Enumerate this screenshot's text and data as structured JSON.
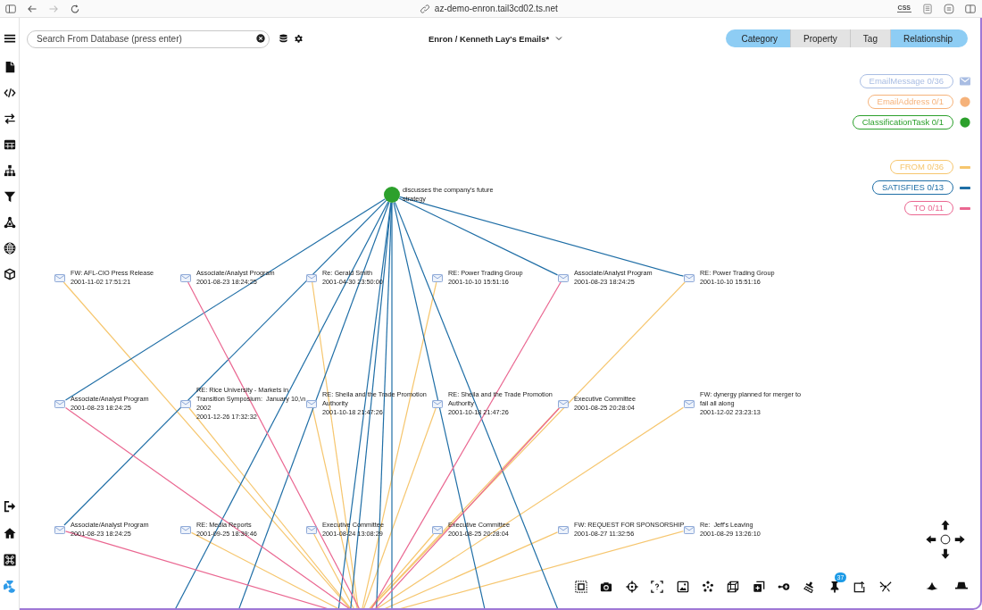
{
  "browser": {
    "url": "az-demo-enron.tail3cd02.ts.net",
    "extension_label": "CSS"
  },
  "header": {
    "search": {
      "placeholder": "Search From Database (press enter)"
    },
    "title": "Enron / Kenneth Lay's Emails*",
    "view_modes": [
      {
        "label": "Category",
        "selected": true
      },
      {
        "label": "Property",
        "selected": false
      },
      {
        "label": "Tag",
        "selected": false
      },
      {
        "label": "Relationship",
        "selected": true
      }
    ]
  },
  "legend": {
    "categories": [
      {
        "label": "EmailMessage 0/36",
        "kind": "message",
        "color": "#a9bde3"
      },
      {
        "label": "EmailAddress 0/1",
        "kind": "address",
        "color": "#f5b27a"
      },
      {
        "label": "ClassificationTask 0/1",
        "kind": "task",
        "color": "#2ca02c"
      }
    ],
    "relationships": [
      {
        "label": "FROM 0/36",
        "kind": "from",
        "color": "#f6c66e"
      },
      {
        "label": "SATISFIES 0/13",
        "kind": "satisfies",
        "color": "#1f6ea6"
      },
      {
        "label": "TO 0/11",
        "kind": "to",
        "color": "#ea6791"
      }
    ]
  },
  "graph": {
    "task_node": {
      "label": "discusses the company's future strategy"
    },
    "email_nodes": [
      {
        "title": "FW: AFL-CIO Press Release",
        "date": "2001-11-02 17:51:21",
        "links": [
          {
            "kind": "from"
          }
        ]
      },
      {
        "title": "Associate/Analyst Program",
        "date": "2001-08-23 18:24:25",
        "links": [
          {
            "kind": "to"
          }
        ]
      },
      {
        "title": "Re: Gerald Smith",
        "date": "2001-04-30 23:50:00",
        "links": [
          {
            "kind": "from"
          }
        ]
      },
      {
        "title": "RE: Power Trading Group",
        "date": "2001-10-10 15:51:16",
        "links": [
          {
            "kind": "from"
          }
        ]
      },
      {
        "title": "Associate/Analyst Program",
        "date": "2001-08-23 18:24:25",
        "links": [
          {
            "kind": "satisfies"
          },
          {
            "kind": "to"
          }
        ]
      },
      {
        "title": "RE: Power Trading Group",
        "date": "2001-10-10 15:51:16",
        "links": [
          {
            "kind": "satisfies"
          },
          {
            "kind": "from"
          }
        ]
      },
      {
        "title": "Associate/Analyst Program",
        "date": "2001-08-23 18:24:25",
        "links": [
          {
            "kind": "satisfies"
          },
          {
            "kind": "to"
          }
        ]
      },
      {
        "title": "RE: Rice University - Markets in Transition Symposium:  January 10,\\n 2002",
        "date": "2001-12-26 17:32:32",
        "links": [
          {
            "kind": "from"
          }
        ]
      },
      {
        "title": "RE: Sheila and the Trade Promotion Authority",
        "date": "2001-10-18 21:47:26",
        "links": [
          {
            "kind": "from"
          }
        ]
      },
      {
        "title": "RE: Sheila and the Trade Promotion Authority",
        "date": "2001-10-18 21:47:26",
        "links": [
          {
            "kind": "from"
          }
        ]
      },
      {
        "title": "Executive Committee",
        "date": "2001-08-25 20:28:04",
        "links": [
          {
            "kind": "from"
          },
          {
            "kind": "to"
          }
        ]
      },
      {
        "title": "FW: dynergy planned for merger to fail all along",
        "date": "2001-12-02 23:23:13",
        "links": [
          {
            "kind": "from"
          }
        ]
      },
      {
        "title": "Associate/Analyst Program",
        "date": "2001-08-23 18:24:25",
        "links": [
          {
            "kind": "satisfies"
          },
          {
            "kind": "to"
          }
        ]
      },
      {
        "title": "RE: Media Reports",
        "date": "2001-09-25 18:39:46",
        "links": [
          {
            "kind": "from"
          }
        ]
      },
      {
        "title": "Executive Committee",
        "date": "2001-08-24 13:08:29",
        "links": [
          {
            "kind": "from"
          }
        ]
      },
      {
        "title": "Executive Committee",
        "date": "2001-08-25 20:28:04",
        "links": [
          {
            "kind": "from"
          }
        ]
      },
      {
        "title": "FW: REQUEST FOR SPONSORSHIP",
        "date": "2001-08-27 11:32:56",
        "links": [
          {
            "kind": "from"
          }
        ]
      },
      {
        "title": "Re:  Jeff's Leaving",
        "date": "2001-08-29 13:26:10",
        "links": [
          {
            "kind": "from"
          }
        ]
      }
    ],
    "offscreen_links": [
      {
        "kind": "satisfies"
      },
      {
        "kind": "satisfies"
      },
      {
        "kind": "satisfies"
      },
      {
        "kind": "satisfies"
      },
      {
        "kind": "satisfies"
      },
      {
        "kind": "satisfies"
      },
      {
        "kind": "satisfies"
      },
      {
        "kind": "satisfies"
      }
    ]
  },
  "toolbar": {
    "pin_badge": "37"
  }
}
